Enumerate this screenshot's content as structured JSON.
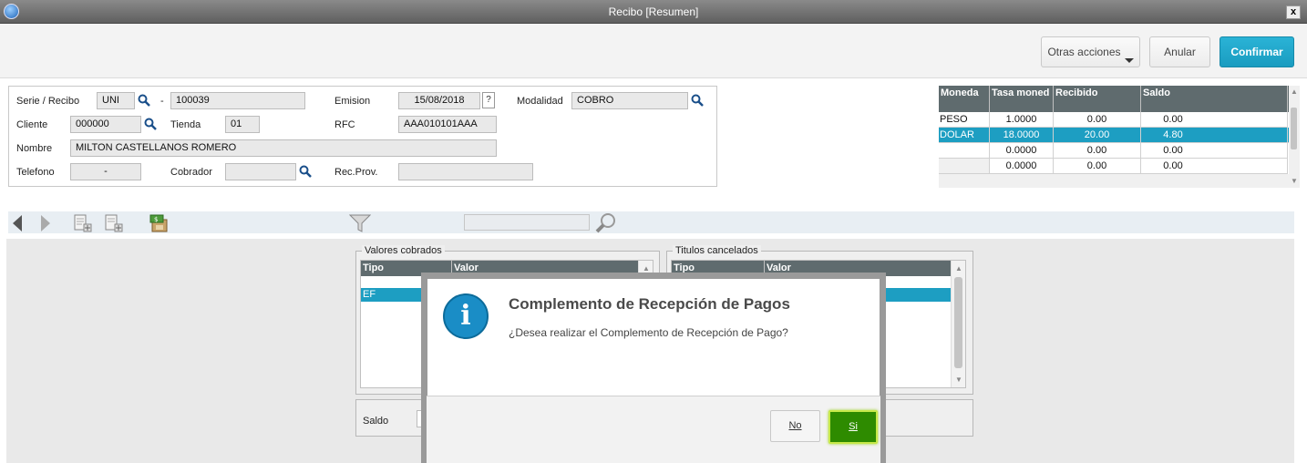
{
  "window": {
    "title": "Recibo [Resumen]",
    "close_label": "x"
  },
  "toolbar": {
    "otras_label": "Otras acciones",
    "anular_label": "Anular",
    "confirmar_label": "Confirmar"
  },
  "form": {
    "serie_label": "Serie / Recibo",
    "serie_value": "UNI",
    "dash": "-",
    "recibo_value": "100039",
    "emision_label": "Emision",
    "emision_value": "15/08/2018",
    "help_label": "?",
    "modalidad_label": "Modalidad",
    "modalidad_value": "COBRO",
    "cliente_label": "Cliente",
    "cliente_value": "000000",
    "tienda_label": "Tienda",
    "tienda_value": "01",
    "rfc_label": "RFC",
    "rfc_value": "AAA010101AAA",
    "nombre_label": "Nombre",
    "nombre_value": "MILTON CASTELLANOS ROMERO",
    "telefono_label": "Telefono",
    "telefono_value": "-",
    "cobrador_label": "Cobrador",
    "cobrador_value": "",
    "recprov_label": "Rec.Prov.",
    "recprov_value": ""
  },
  "currency_grid": {
    "headers": [
      "Moneda",
      "Tasa moned",
      "Recibido",
      "Saldo"
    ],
    "rows": [
      [
        "PESO",
        "1.0000",
        "0.00",
        "0.00"
      ],
      [
        "DOLAR",
        "18.0000",
        "20.00",
        "4.80"
      ],
      [
        "",
        "0.0000",
        "0.00",
        "0.00"
      ],
      [
        "",
        "0.0000",
        "0.00",
        "0.00"
      ]
    ],
    "selected_row": 1
  },
  "valores": {
    "title": "Valores cobrados",
    "headers": [
      "Tipo",
      "Valor"
    ],
    "row": [
      "EF",
      ""
    ]
  },
  "titulos": {
    "title": "Titulos cancelados",
    "headers": [
      "Tipo",
      "Valor"
    ]
  },
  "saldo": {
    "label": "Saldo"
  },
  "modal": {
    "title": "Complemento de Recepción de Pagos",
    "message": "¿Desea realizar el Complemento de Recepción de Pago?",
    "no_label": "No",
    "si_label": "Si"
  },
  "colors": {
    "accent": "#1d9ec2",
    "confirm": "#2e8b00",
    "header_grid": "#5f6b6e"
  }
}
